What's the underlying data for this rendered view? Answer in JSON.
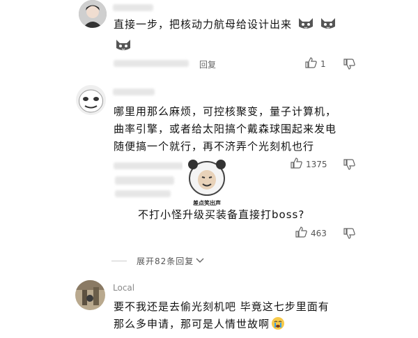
{
  "comments": [
    {
      "text_lines": [
        "直接一步，把核动力航母给设计出来"
      ],
      "reply_label": "回复",
      "like_count": "1",
      "emoji": "cat-emoji"
    },
    {
      "text_lines": [
        "哪里用那么麻烦，可控核聚变，量子计算机，",
        "曲率引擎，或者给太阳搞个戴森球围起来发电",
        "随便搞一个就行，再不济弄个光刻机也行"
      ],
      "like_count": "1375",
      "reply_label": "回复",
      "sticker_caption": "差点笑出声",
      "reply": {
        "text": "不打小怪升级买装备直接打boss?",
        "like_count": "463"
      },
      "expand_label": "展开82条回复"
    },
    {
      "username": "Local",
      "text_lines": [
        "要不我还是去偷光刻机吧 毕竟这七步里面有",
        "那么多申请，那可是人情世故啊"
      ],
      "emoji": "crying-face-emoji"
    }
  ],
  "icons": {
    "like": "thumbs-up-icon",
    "dislike": "thumbs-down-icon",
    "expand": "chevron-down-icon"
  }
}
